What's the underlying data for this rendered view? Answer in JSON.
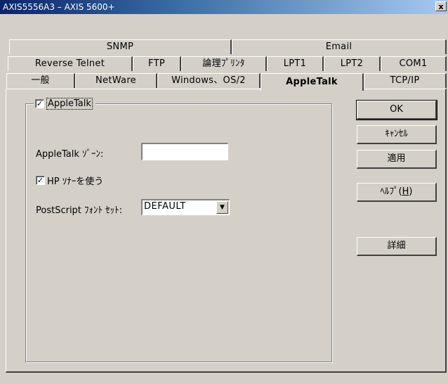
{
  "window": {
    "title": "AXIS5556A3 – AXIS 5600+",
    "close_label": "x"
  },
  "tabs": {
    "row1": [
      "SNMP",
      "Email"
    ],
    "row2": [
      "Reverse Telnet",
      "FTP",
      "論理ﾌﾟﾘﾝﾀ",
      "LPT1",
      "LPT2",
      "COM1"
    ],
    "row3": [
      "一般",
      "NetWare",
      "Windows、OS/2",
      "AppleTalk",
      "TCP/IP"
    ],
    "active": "AppleTalk"
  },
  "group": {
    "checkbox_label": "AppleTalk",
    "checked": true
  },
  "form": {
    "zone_label": "AppleTalk ｿﾞｰﾝ:",
    "zone_value": "",
    "hp_sonar_label": "HP ｿﾅｰを使う",
    "hp_sonar_checked": true,
    "font_set_label": "PostScript ﾌｫﾝﾄ ｾｯﾄ:",
    "font_set_value": "DEFAULT"
  },
  "buttons": {
    "ok": "OK",
    "cancel": "ｷｬﾝｾﾙ",
    "apply": "適用",
    "help": "ﾍﾙﾌﾟ(",
    "help_accel": "H",
    "help_close": ")",
    "details": "詳細"
  },
  "colors": {
    "face": "#d4d0c8",
    "title_start": "#0a246a",
    "title_end": "#a6caf0"
  }
}
